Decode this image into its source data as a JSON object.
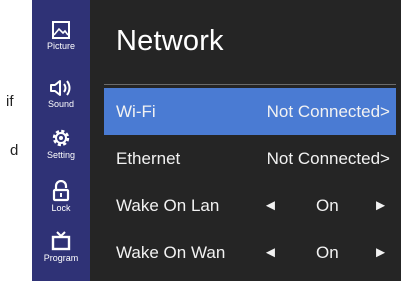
{
  "background_fragments": [
    "if",
    "d"
  ],
  "sidebar": {
    "items": [
      {
        "label": "Picture",
        "icon": "picture-icon"
      },
      {
        "label": "Sound",
        "icon": "speaker-icon"
      },
      {
        "label": "Setting",
        "icon": "gear-icon"
      },
      {
        "label": "Lock",
        "icon": "lock-icon"
      },
      {
        "label": "Program",
        "icon": "tv-icon"
      }
    ]
  },
  "main": {
    "title": "Network",
    "rows": [
      {
        "label": "Wi-Fi",
        "value": "Not Connected>",
        "selected": true
      },
      {
        "label": "Ethernet",
        "value": "Not Connected>",
        "selected": false
      },
      {
        "label": "Wake On Lan",
        "left_arrow": "◄",
        "value": "On",
        "right_arrow": "►"
      },
      {
        "label": "Wake On Wan",
        "left_arrow": "◄",
        "value": "On",
        "right_arrow": "►"
      }
    ]
  },
  "colors": {
    "sidebar": "#2f3276",
    "panel": "#252525",
    "selected_row": "#4a7bd3"
  }
}
